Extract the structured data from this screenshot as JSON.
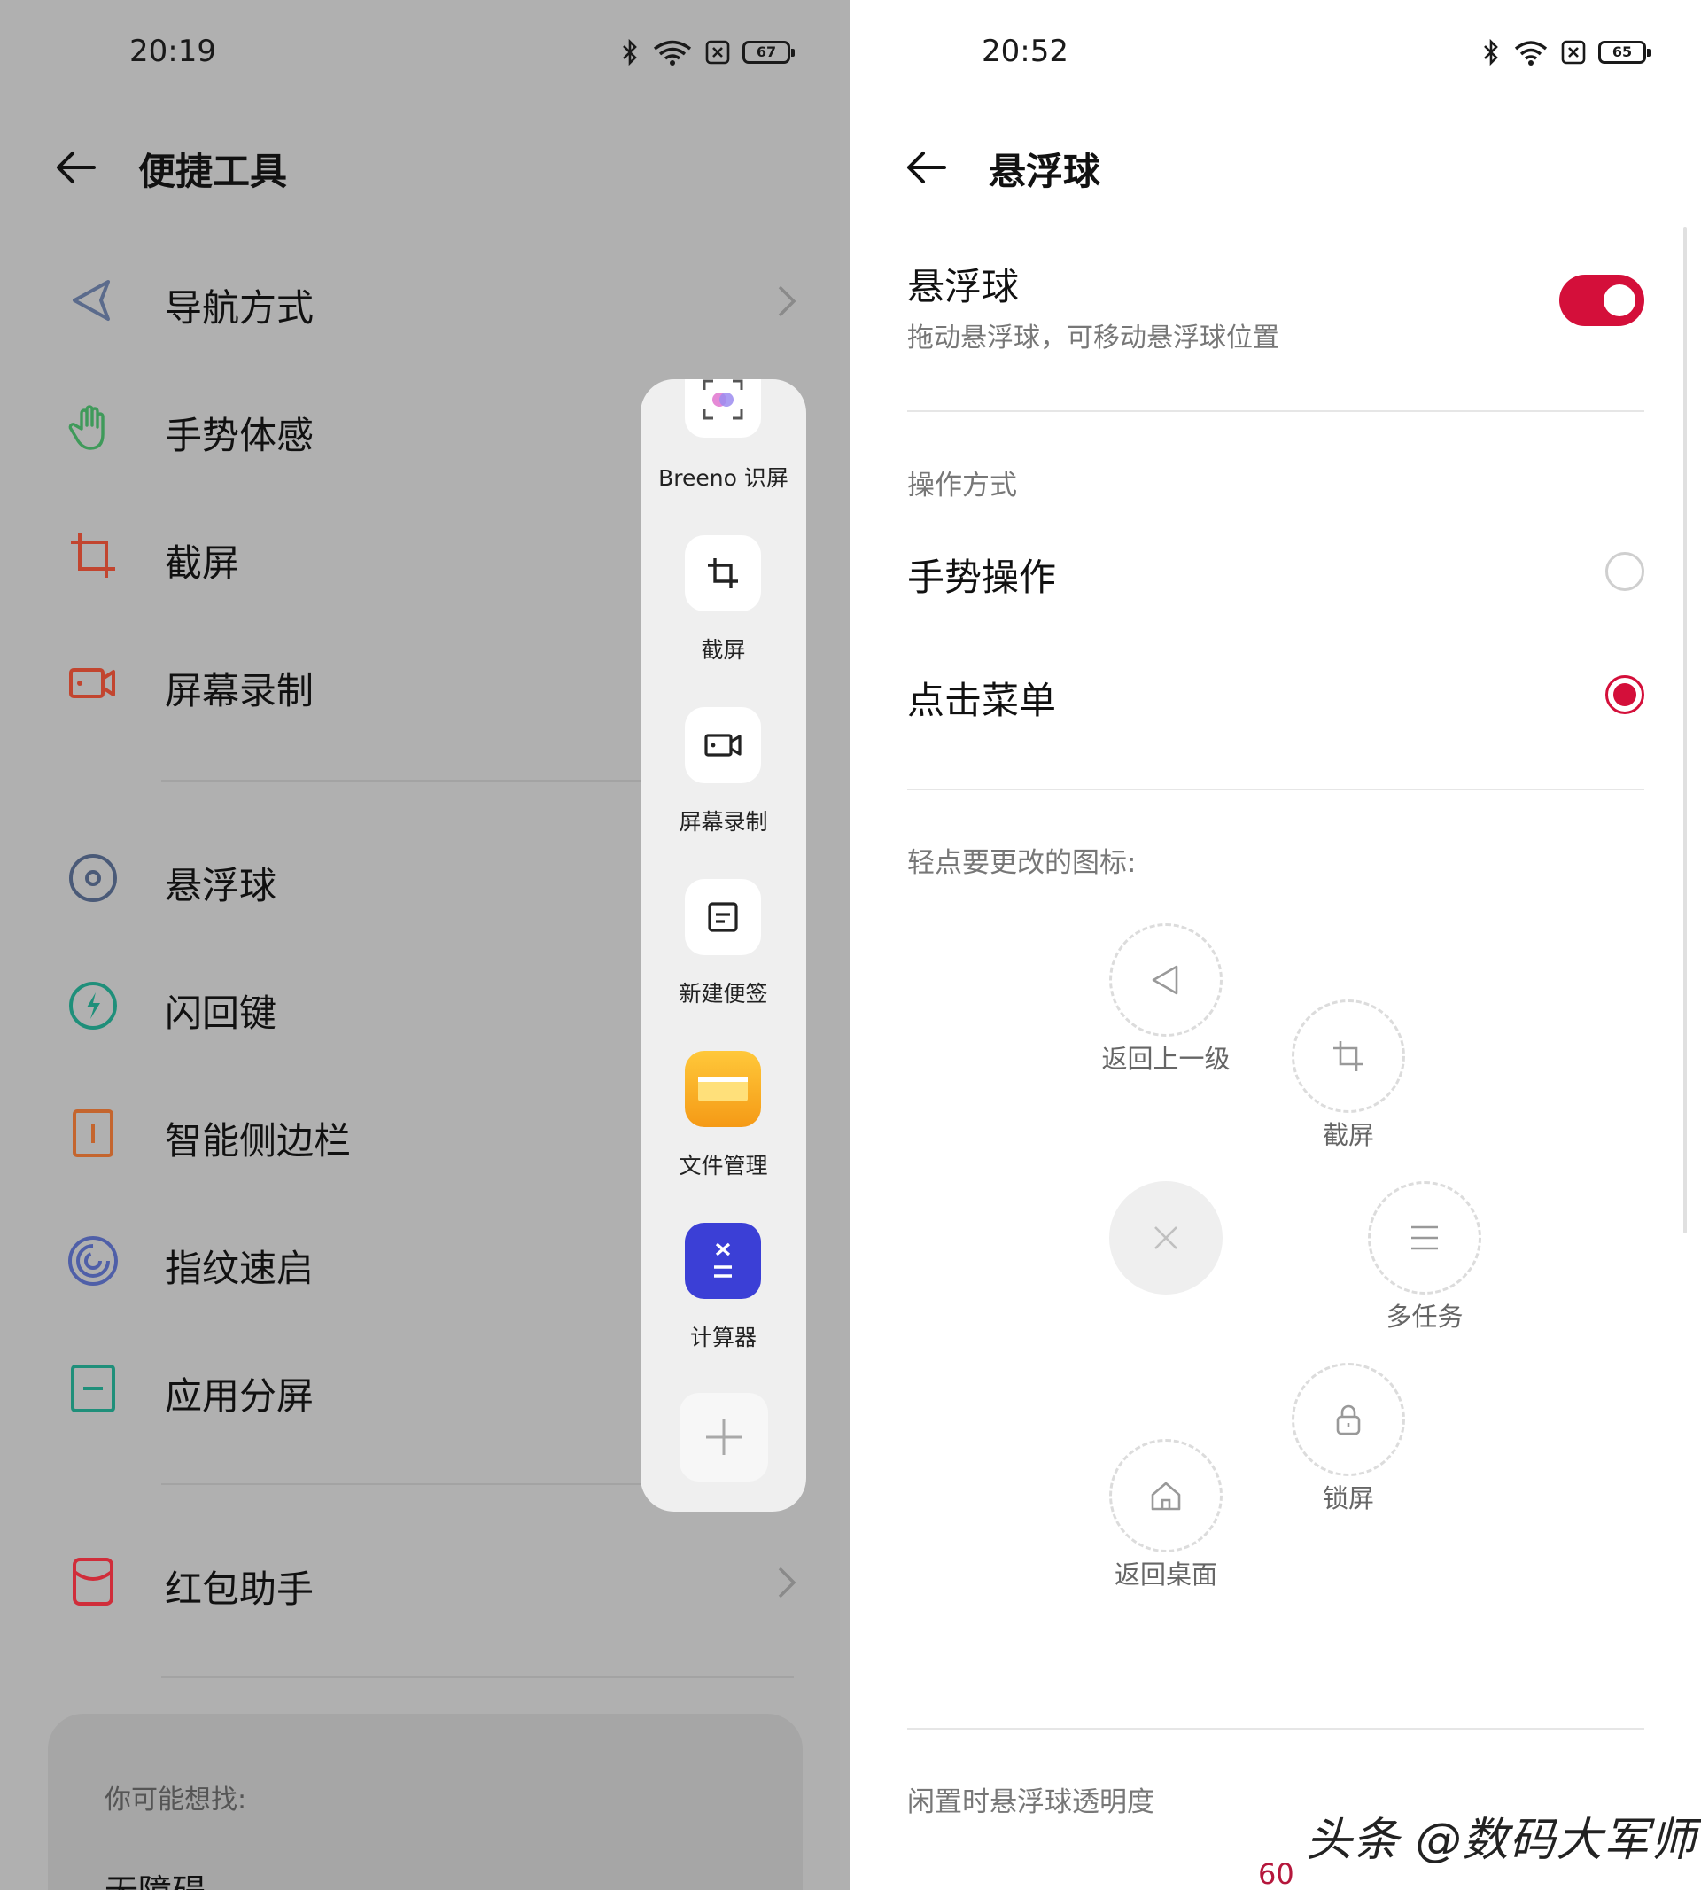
{
  "left": {
    "status": {
      "time": "20:19",
      "battery": "67"
    },
    "header": {
      "title": "便捷工具"
    },
    "menu": [
      {
        "label": "导航方式",
        "icon": "navigation-triangle-icon",
        "color": "#5b6b8c"
      },
      {
        "label": "手势体感",
        "icon": "hand-gesture-icon",
        "color": "#3f9a5a"
      },
      {
        "label": "截屏",
        "icon": "crop-icon",
        "color": "#c2452f"
      },
      {
        "label": "屏幕录制",
        "icon": "video-record-icon",
        "color": "#c2452f"
      },
      {
        "label": "悬浮球",
        "icon": "floating-ball-icon",
        "color": "#4a5a78"
      },
      {
        "label": "闪回键",
        "icon": "flash-icon",
        "color": "#1f8f7a"
      },
      {
        "label": "智能侧边栏",
        "icon": "sidebar-icon",
        "color": "#c4652e"
      },
      {
        "label": "指纹速启",
        "icon": "fingerprint-icon",
        "color": "#4f5fa8"
      },
      {
        "label": "应用分屏",
        "icon": "split-screen-icon",
        "color": "#1f8f7a"
      },
      {
        "label": "红包助手",
        "icon": "red-envelope-icon",
        "color": "#d02d3a"
      }
    ],
    "suggest": {
      "title": "你可能想找:",
      "item": "无障碍"
    },
    "dock": [
      {
        "label": "Breeno 识屏",
        "icon": "breeno-scan-icon"
      },
      {
        "label": "截屏",
        "icon": "crop-icon"
      },
      {
        "label": "屏幕录制",
        "icon": "video-record-icon"
      },
      {
        "label": "新建便签",
        "icon": "note-icon"
      },
      {
        "label": "文件管理",
        "icon": "folder-icon"
      },
      {
        "label": "计算器",
        "icon": "calculator-icon"
      },
      {
        "label": "",
        "icon": "add-icon"
      }
    ]
  },
  "right": {
    "status": {
      "time": "20:52",
      "battery": "65"
    },
    "header": {
      "title": "悬浮球"
    },
    "toggle": {
      "title": "悬浮球",
      "subtitle": "拖动悬浮球，可移动悬浮球位置",
      "on": true
    },
    "mode_section": "操作方式",
    "modes": [
      {
        "label": "手势操作",
        "selected": false
      },
      {
        "label": "点击菜单",
        "selected": true
      }
    ],
    "icons_section": "轻点要更改的图标:",
    "ring_items": [
      {
        "label": "返回上一级",
        "icon": "back-triangle-icon"
      },
      {
        "label": "截屏",
        "icon": "crop-icon"
      },
      {
        "label": "多任务",
        "icon": "menu-lines-icon"
      },
      {
        "label": "锁屏",
        "icon": "lock-icon"
      },
      {
        "label": "返回桌面",
        "icon": "home-icon"
      },
      {
        "label": "",
        "icon": "close-icon"
      }
    ],
    "opacity": {
      "label": "闲置时悬浮球透明度",
      "value": "60"
    }
  },
  "watermark": "头条 @数码大军师",
  "colors": {
    "accent": "#d40f3a",
    "left_bg": "#b0b0b0",
    "dock_bg": "#efefef"
  }
}
